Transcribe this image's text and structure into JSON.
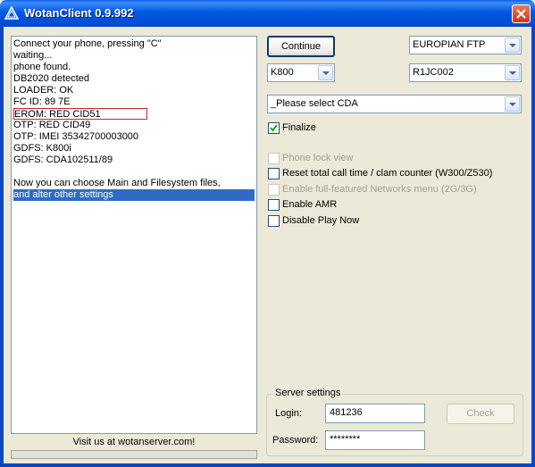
{
  "window": {
    "title": "WotanClient 0.9.992"
  },
  "log": {
    "lines": [
      "Connect your phone, pressing \"C\"",
      "waiting...",
      "phone found.",
      "DB2020 detected",
      "LOADER: OK",
      "FC ID: 89 7E",
      "EROM: RED CID51",
      "OTP: RED CID49",
      "OTP: IMEI 35342700003000",
      "GDFS: K800i",
      "GDFS: CDA102511/89",
      "",
      "Now you can choose Main and Filesystem files,",
      "and alter other settings"
    ]
  },
  "footer": {
    "visit_text": "Visit us at wotanserver.com!"
  },
  "controls": {
    "continue_label": "Continue",
    "region_value": "EUROPIAN FTP",
    "model_value": "K800",
    "firmware_value": "R1JC002",
    "cda_value": "_Please select CDA"
  },
  "options": {
    "finalize": {
      "label": "Finalize",
      "checked": true,
      "enabled": true
    },
    "phone_lock": {
      "label": "Phone lock view",
      "checked": false,
      "enabled": false
    },
    "reset_call_time": {
      "label": "Reset total call time / clam counter (W300/Z530)",
      "checked": false,
      "enabled": true
    },
    "networks_menu": {
      "label": "Enable full-featured Networks menu (2G/3G)",
      "checked": false,
      "enabled": false
    },
    "amr": {
      "label": "Enable AMR",
      "checked": false,
      "enabled": true
    },
    "play_now": {
      "label": "Disable Play Now",
      "checked": false,
      "enabled": true
    }
  },
  "server": {
    "group_title": "Server settings",
    "login_label": "Login:",
    "login_value": "481236",
    "password_label": "Password:",
    "password_value": "********",
    "check_label": "Check"
  },
  "colors": {
    "titlebar": "#0058E3",
    "selection": "#316AC5",
    "highlight_border": "#C0282D",
    "face": "#ECE9D8"
  }
}
